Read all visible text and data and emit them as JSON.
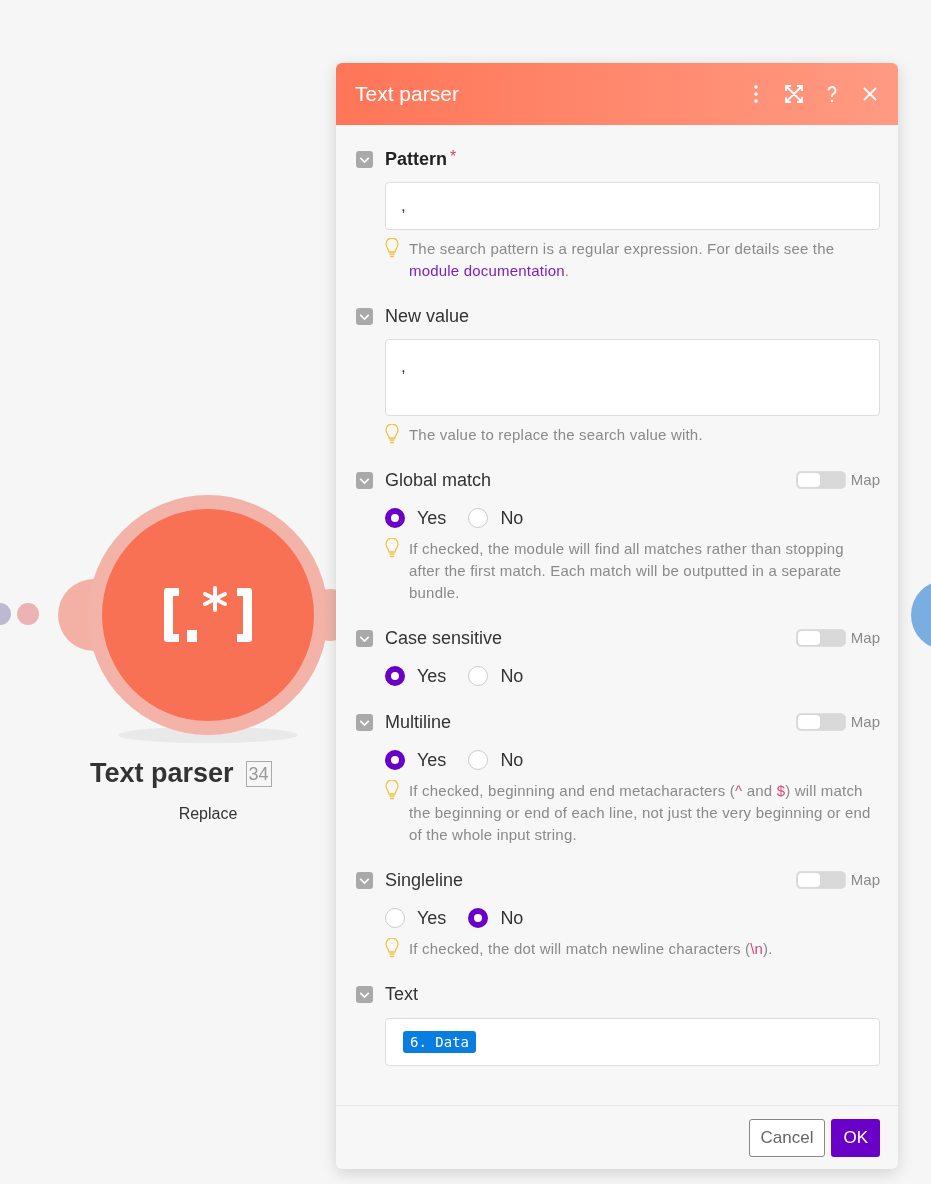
{
  "canvas": {
    "module": {
      "name": "Text parser",
      "count": "34",
      "action": "Replace"
    }
  },
  "panel": {
    "title": "Text parser",
    "fields": [
      {
        "kind": "text",
        "label": "Pattern",
        "required_mark": "*",
        "expanded": true,
        "value": ",",
        "hint": [
          {
            "text": "The search pattern is a regular expression. For details see the ",
            "kind": "plain"
          },
          {
            "text": "module documentation",
            "kind": "link"
          },
          {
            "text": ".",
            "kind": "plain"
          }
        ]
      },
      {
        "kind": "textarea",
        "label": "New value",
        "expanded": true,
        "value": ",",
        "hint": [
          {
            "text": "The value to replace the search value with.",
            "kind": "plain"
          }
        ]
      },
      {
        "kind": "radio",
        "label": "Global match",
        "expanded": true,
        "map": {
          "label": "Map",
          "on": false
        },
        "options": [
          {
            "label": "Yes",
            "selected": true
          },
          {
            "label": "No",
            "selected": false
          }
        ],
        "hint": [
          {
            "text": "If checked, the module will find all matches rather than stopping after the first match. Each match will be outputted in a separate bundle.",
            "kind": "plain"
          }
        ]
      },
      {
        "kind": "radio",
        "label": "Case sensitive",
        "expanded": true,
        "map": {
          "label": "Map",
          "on": false
        },
        "options": [
          {
            "label": "Yes",
            "selected": true
          },
          {
            "label": "No",
            "selected": false
          }
        ]
      },
      {
        "kind": "radio",
        "label": "Multiline",
        "expanded": true,
        "map": {
          "label": "Map",
          "on": false
        },
        "options": [
          {
            "label": "Yes",
            "selected": true
          },
          {
            "label": "No",
            "selected": false
          }
        ],
        "hint": [
          {
            "text": "If checked, beginning and end metacharacters (",
            "kind": "plain"
          },
          {
            "text": "^",
            "kind": "code"
          },
          {
            "text": " and ",
            "kind": "plain"
          },
          {
            "text": "$",
            "kind": "code"
          },
          {
            "text": ") will match the beginning or end of each line, not just the very beginning or end of the whole input string.",
            "kind": "plain"
          }
        ]
      },
      {
        "kind": "radio",
        "label": "Singleline",
        "expanded": true,
        "map": {
          "label": "Map",
          "on": false
        },
        "options": [
          {
            "label": "Yes",
            "selected": false
          },
          {
            "label": "No",
            "selected": true
          }
        ],
        "hint": [
          {
            "text": "If checked, the dot will match newline characters (",
            "kind": "plain"
          },
          {
            "text": "\\n",
            "kind": "code"
          },
          {
            "text": ").",
            "kind": "plain"
          }
        ]
      },
      {
        "kind": "tags",
        "label": "Text",
        "expanded": true,
        "tags": [
          "6. Data"
        ]
      }
    ],
    "buttons": [
      {
        "label": "Cancel",
        "kind": "secondary"
      },
      {
        "label": "OK",
        "kind": "primary"
      }
    ]
  }
}
